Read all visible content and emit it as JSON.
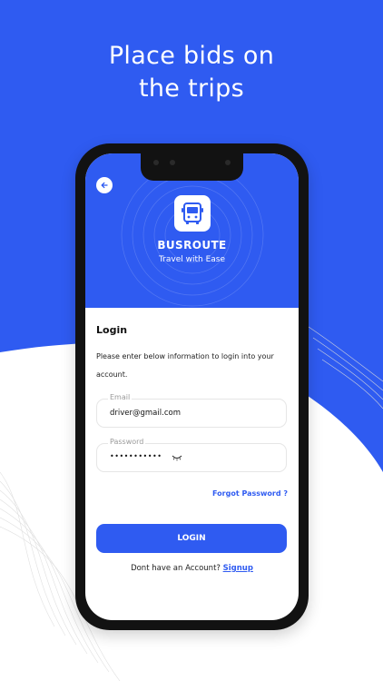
{
  "marketing": {
    "headline_line1": "Place bids on",
    "headline_line2": "the trips"
  },
  "header": {
    "back_icon": "arrow-left-icon",
    "logo_icon": "bus-icon",
    "brand": "BUSROUTE",
    "tagline": "Travel with Ease"
  },
  "form": {
    "title": "Login",
    "description": "Please enter below information to login  into your account.",
    "email": {
      "label": "Email",
      "value": "driver@gmail.com"
    },
    "password": {
      "label": "Password",
      "value": "•••••••••••",
      "toggle_icon": "eye-closed-icon"
    },
    "forgot_label": "Forgot Password ?",
    "login_label": "LOGIN",
    "signup_prompt": "Dont have an Account?",
    "signup_label": "Signup"
  },
  "colors": {
    "primary": "#2f5bf1",
    "white": "#ffffff",
    "text": "#111111"
  }
}
